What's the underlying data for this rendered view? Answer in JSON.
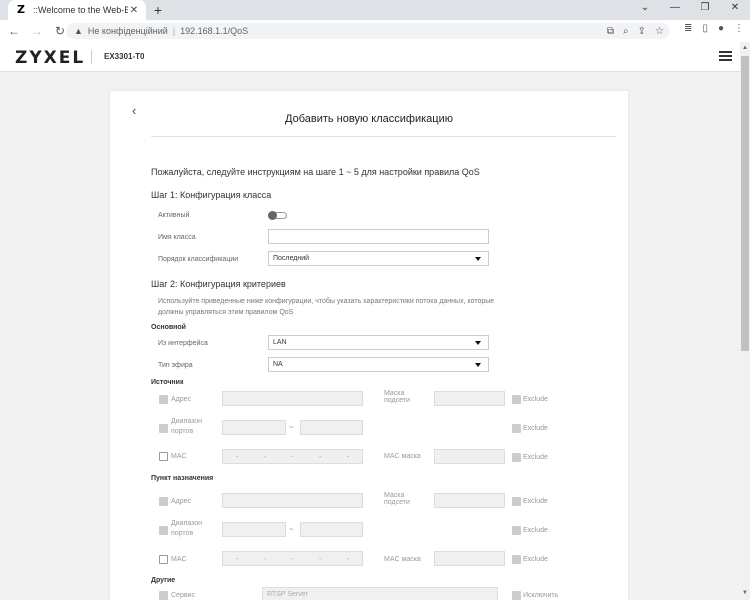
{
  "browser": {
    "tab_title": "::Welcome to the Web-Based Co",
    "favicon_letter": "Z",
    "new_tab_symbol": "+",
    "security_label": "Не конфіденційний",
    "url": "192.168.1.1/QoS"
  },
  "header": {
    "logo": "ZYXEL",
    "model": "EX3301-T0"
  },
  "card": {
    "back_symbol": "‹",
    "title": "Добавить новую классификацию",
    "intro": "Пожалуйста, следуйте инструкциям на шаге 1 ~ 5 для настройки правила QoS",
    "step1": {
      "heading": "Шаг 1: Конфигурация класса",
      "active_label": "Активный",
      "class_name_label": "Имя класса",
      "class_name_value": "",
      "order_label": "Порядок классификации",
      "order_value": "Последний"
    },
    "step2": {
      "heading": "Шаг 2: Конфигурация критериев",
      "help": "Используйте приведенные ниже конфигурации, чтобы указать характеристики потока данных, которые должны управляться этим правилом QoS",
      "basic_label": "Основной",
      "from_interface_label": "Из интерфейса",
      "from_interface_value": "LAN",
      "ether_type_label": "Тип эфира",
      "ether_type_value": "NA",
      "source": {
        "label": "Источник",
        "address_label": "Адрес",
        "mask_label": "Маска подсети",
        "port_range_label": "Диапазон портов",
        "mac_label": "MAC",
        "mac_mask_label": "MAC маска",
        "exclude_label": "Exclude",
        "range_dash": "~",
        "mac_sep": "-"
      },
      "destination": {
        "label": "Пункт назначения",
        "address_label": "Адрес",
        "mask_label": "Маска подсети",
        "port_range_label": "Диапазон портов",
        "mac_label": "MAC",
        "mac_mask_label": "MAC маска",
        "exclude_label": "Exclude",
        "range_dash": "~",
        "mac_sep": "-"
      },
      "other": {
        "label": "Другие",
        "service_label": "Сервис",
        "service_value": "RTSP Server",
        "exclude_label": "Исключить"
      }
    }
  }
}
